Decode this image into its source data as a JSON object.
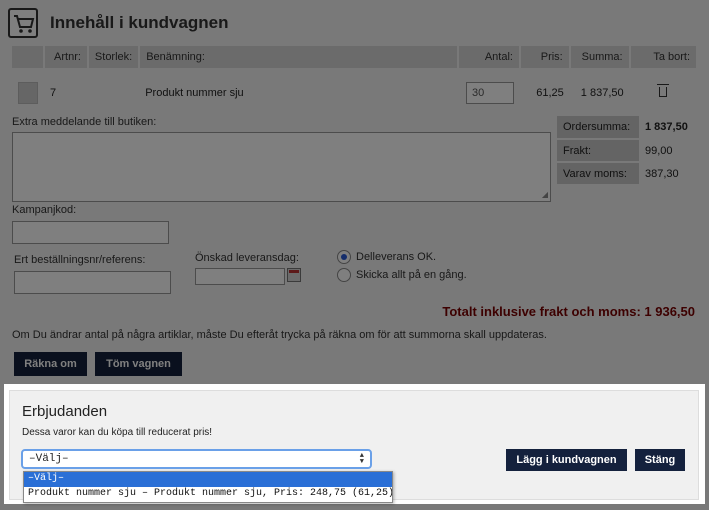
{
  "header": {
    "title": "Innehåll i kundvagnen"
  },
  "cart": {
    "columns": [
      "Artnr:",
      "Storlek:",
      "Benämning:",
      "Antal:",
      "Pris:",
      "Summa:",
      "Ta bort:"
    ],
    "rows": [
      {
        "artnr": "7",
        "storlek": "",
        "benamning": "Produkt nummer sju",
        "antal": "30",
        "pris": "61,25",
        "summa": "1 837,50"
      }
    ]
  },
  "form": {
    "extra_message_label": "Extra meddelande till butiken:",
    "campaign_label": "Kampanjkod:",
    "reference_label": "Ert beställningsnr/referens:",
    "delivery_date_label": "Önskad leveransdag:",
    "radio_partial": "Delleverans OK.",
    "radio_all": "Skicka allt på en gång."
  },
  "summary": [
    {
      "label": "Ordersumma:",
      "value": "1 837,50"
    },
    {
      "label": "Frakt:",
      "value": "99,00"
    },
    {
      "label": "Varav moms:",
      "value": "387,30"
    }
  ],
  "total_text": "Totalt inklusive frakt och moms: 1 936,50",
  "note": "Om Du ändrar antal på några artiklar, måste Du efteråt trycka på räkna om för att summorna skall uppdateras.",
  "buttons": {
    "recalc": "Räkna om",
    "empty": "Töm vagnen"
  },
  "modal": {
    "title": "Erbjudanden",
    "subtitle": "Dessa varor kan du köpa till reducerat pris!",
    "select_value": "–Välj–",
    "options": [
      "–Välj–",
      "Produkt nummer sju – Produkt nummer sju, Pris: 248,75 (61,25)"
    ],
    "add_button": "Lägg i kundvagnen",
    "close_button": "Stäng"
  },
  "colors": {
    "button_bg": "#14213d",
    "total_color": "#7a0000",
    "selected_option": "#2a6fd6"
  }
}
